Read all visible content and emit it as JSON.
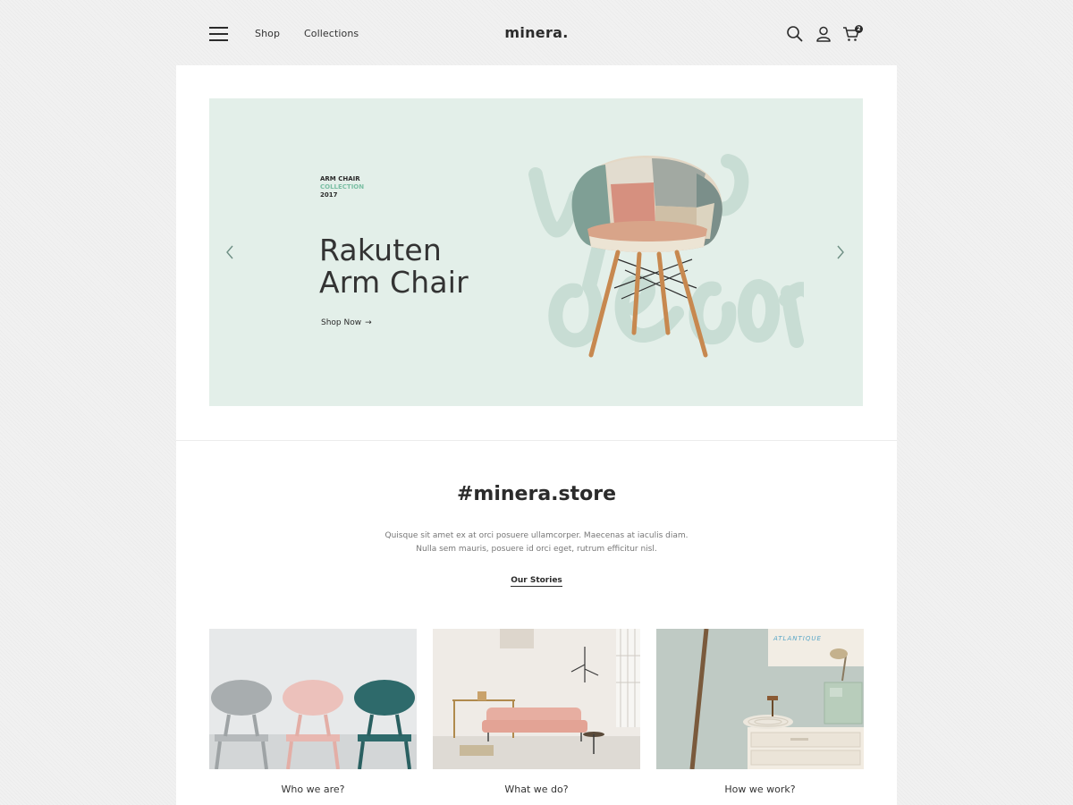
{
  "header": {
    "nav": {
      "shop": "Shop",
      "collections": "Collections"
    },
    "logo": "minera.",
    "cart_count": "2"
  },
  "hero": {
    "eyebrow": {
      "line1": "ARM CHAIR",
      "line2": "COLLECTION",
      "line3": "2017"
    },
    "title_line1": "Rakuten",
    "title_line2": "Arm Chair",
    "cta": "Shop Now",
    "cta_arrow": "→",
    "background": "#e3efe9"
  },
  "store": {
    "title": "#minera.store",
    "description": "Quisque sit amet ex at orci posuere ullamcorper. Maecenas at iaculis diam. Nulla sem mauris, posuere id orci eget, rutrum efficitur nisl.",
    "link": "Our Stories"
  },
  "features": [
    {
      "caption": "Who we are?"
    },
    {
      "caption": "What we do?"
    },
    {
      "caption": "How we work?"
    }
  ],
  "colors": {
    "accent": "#7bbfa4",
    "text": "#2b2b2b",
    "hero_bg": "#e3efe9"
  }
}
